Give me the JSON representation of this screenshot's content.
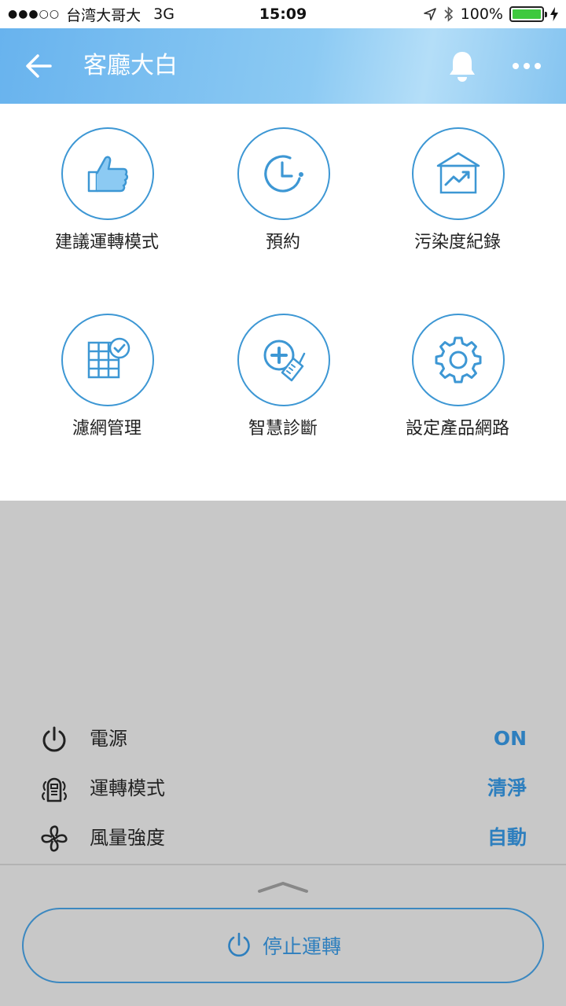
{
  "status_bar": {
    "signal": "●●●○○",
    "carrier": "台湾大哥大",
    "network": "3G",
    "time": "15:09",
    "battery": "100%"
  },
  "header": {
    "title": "客廳大白"
  },
  "grid": {
    "items": [
      {
        "label": "建議運轉模式",
        "icon": "thumbs-up-icon"
      },
      {
        "label": "預約",
        "icon": "clock-icon"
      },
      {
        "label": "污染度紀錄",
        "icon": "chart-icon"
      },
      {
        "label": "濾網管理",
        "icon": "filter-icon"
      },
      {
        "label": "智慧診斷",
        "icon": "diagnosis-icon"
      },
      {
        "label": "設定產品網路",
        "icon": "gear-icon"
      }
    ]
  },
  "status_panel": {
    "rows": [
      {
        "label": "電源",
        "value": "ON",
        "icon": "power-icon"
      },
      {
        "label": "運轉模式",
        "value": "清淨",
        "icon": "mode-icon"
      },
      {
        "label": "風量強度",
        "value": "自動",
        "icon": "fan-icon"
      }
    ]
  },
  "stop_button": {
    "label": "停止運轉"
  },
  "colors": {
    "accent": "#2e7fbe",
    "circle_border": "#3d97d4",
    "battery": "#3ec93e"
  }
}
